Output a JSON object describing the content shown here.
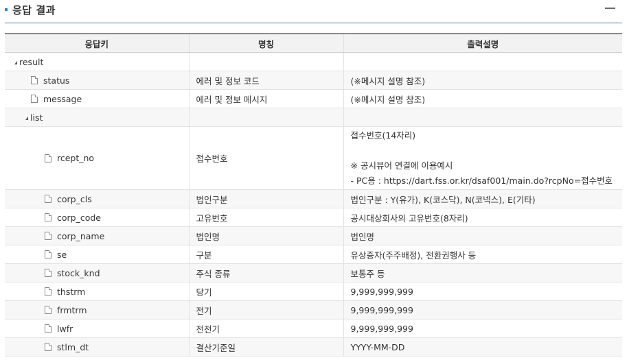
{
  "section": {
    "title": "응답 결과"
  },
  "table": {
    "headers": [
      "응답키",
      "명칭",
      "출력설명"
    ],
    "rows": [
      {
        "key": "result",
        "name": "",
        "desc": ""
      },
      {
        "key": "status",
        "name": "에러 및 정보 코드",
        "desc": "(※메시지 설명 참조)"
      },
      {
        "key": "message",
        "name": "에러 및 정보 메시지",
        "desc": "(※메시지 설명 참조)"
      },
      {
        "key": "list",
        "name": "",
        "desc": ""
      },
      {
        "key": "rcept_no",
        "name": "접수번호",
        "desc_lines": [
          "접수번호(14자리)",
          "※ 공시뷰어 연결에 이용예시",
          "- PC용 : https://dart.fss.or.kr/dsaf001/main.do?rcpNo=접수번호"
        ]
      },
      {
        "key": "corp_cls",
        "name": "법인구분",
        "desc": "법인구분 : Y(유가), K(코스닥), N(코넥스), E(기타)"
      },
      {
        "key": "corp_code",
        "name": "고유번호",
        "desc": "공시대상회사의 고유번호(8자리)"
      },
      {
        "key": "corp_name",
        "name": "법인명",
        "desc": "법인명"
      },
      {
        "key": "se",
        "name": "구분",
        "desc": "유상증자(주주배정), 전환권행사 등"
      },
      {
        "key": "stock_knd",
        "name": "주식 종류",
        "desc": "보통주 등"
      },
      {
        "key": "thstrm",
        "name": "당기",
        "desc": "9,999,999,999"
      },
      {
        "key": "frmtrm",
        "name": "전기",
        "desc": "9,999,999,999"
      },
      {
        "key": "lwfr",
        "name": "전전기",
        "desc": "9,999,999,999"
      },
      {
        "key": "stlm_dt",
        "name": "결산기준일",
        "desc": "YYYY-MM-DD"
      }
    ]
  },
  "icons": {
    "bullet": "square-bullet-icon",
    "collapse": "minus-icon",
    "expanded": "triangle-expanded-icon",
    "leaf": "document-icon"
  },
  "colors": {
    "accent": "#2e7fbf",
    "header_bg": "#f2f2f2",
    "row_shade": "#f7f7f7"
  }
}
